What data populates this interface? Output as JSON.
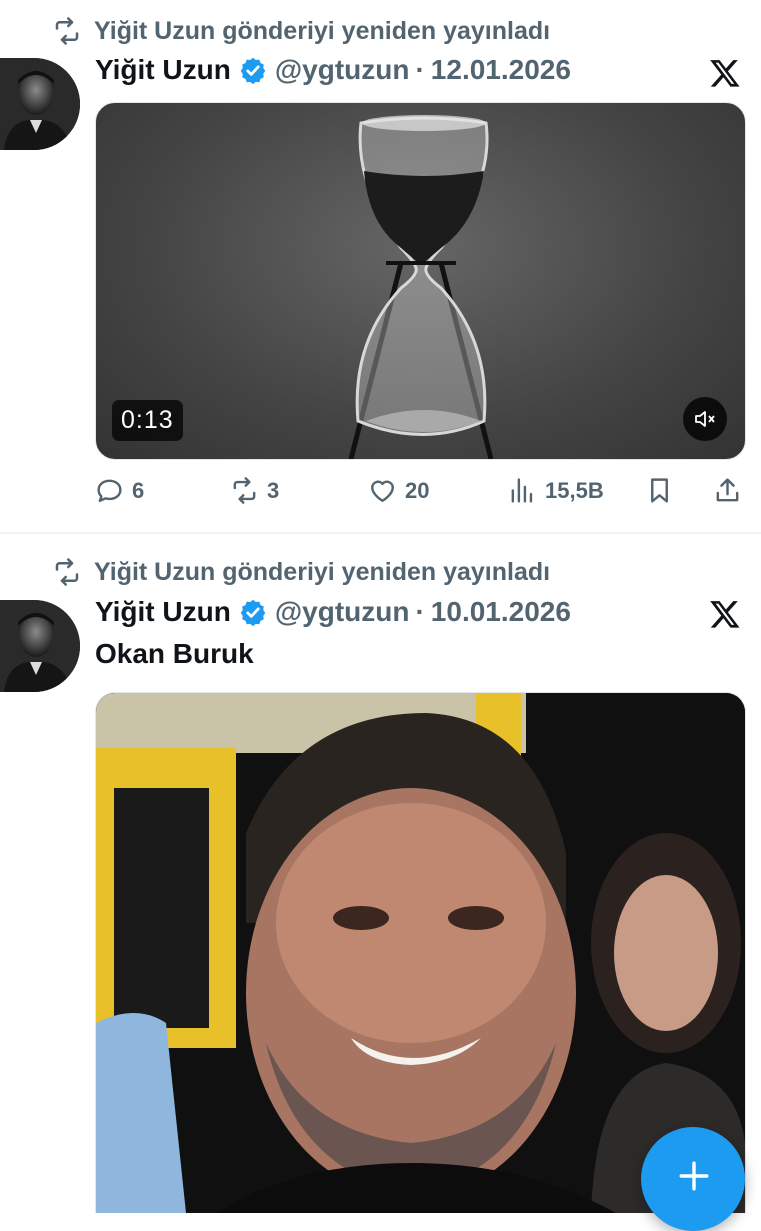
{
  "tweets": [
    {
      "retweet_label": "Yiğit Uzun gönderiyi yeniden yayınladı",
      "author_name": "Yiğit Uzun",
      "handle": "@ygtuzun",
      "separator": "·",
      "date": "12.01.2026",
      "media": {
        "type": "video",
        "duration": "0:13",
        "muted": true,
        "subject": "hourglass"
      },
      "stats": {
        "replies": "6",
        "reposts": "3",
        "likes": "20",
        "views": "15,5B"
      }
    },
    {
      "retweet_label": "Yiğit Uzun gönderiyi yeniden yayınladı",
      "author_name": "Yiğit Uzun",
      "handle": "@ygtuzun",
      "separator": "·",
      "date": "10.01.2026",
      "text": "Okan Buruk",
      "media": {
        "type": "photo"
      }
    }
  ],
  "icons": {
    "retweet": "retweet-icon",
    "verified": "verified-badge-icon",
    "x_logo": "x-logo-icon",
    "reply": "reply-icon",
    "like": "heart-icon",
    "views": "views-icon",
    "bookmark": "bookmark-icon",
    "share": "share-icon",
    "mute": "muted-speaker-icon",
    "compose": "plus-icon"
  },
  "colors": {
    "accent": "#1d9bf0",
    "text": "#0f1419",
    "secondary": "#536471"
  }
}
